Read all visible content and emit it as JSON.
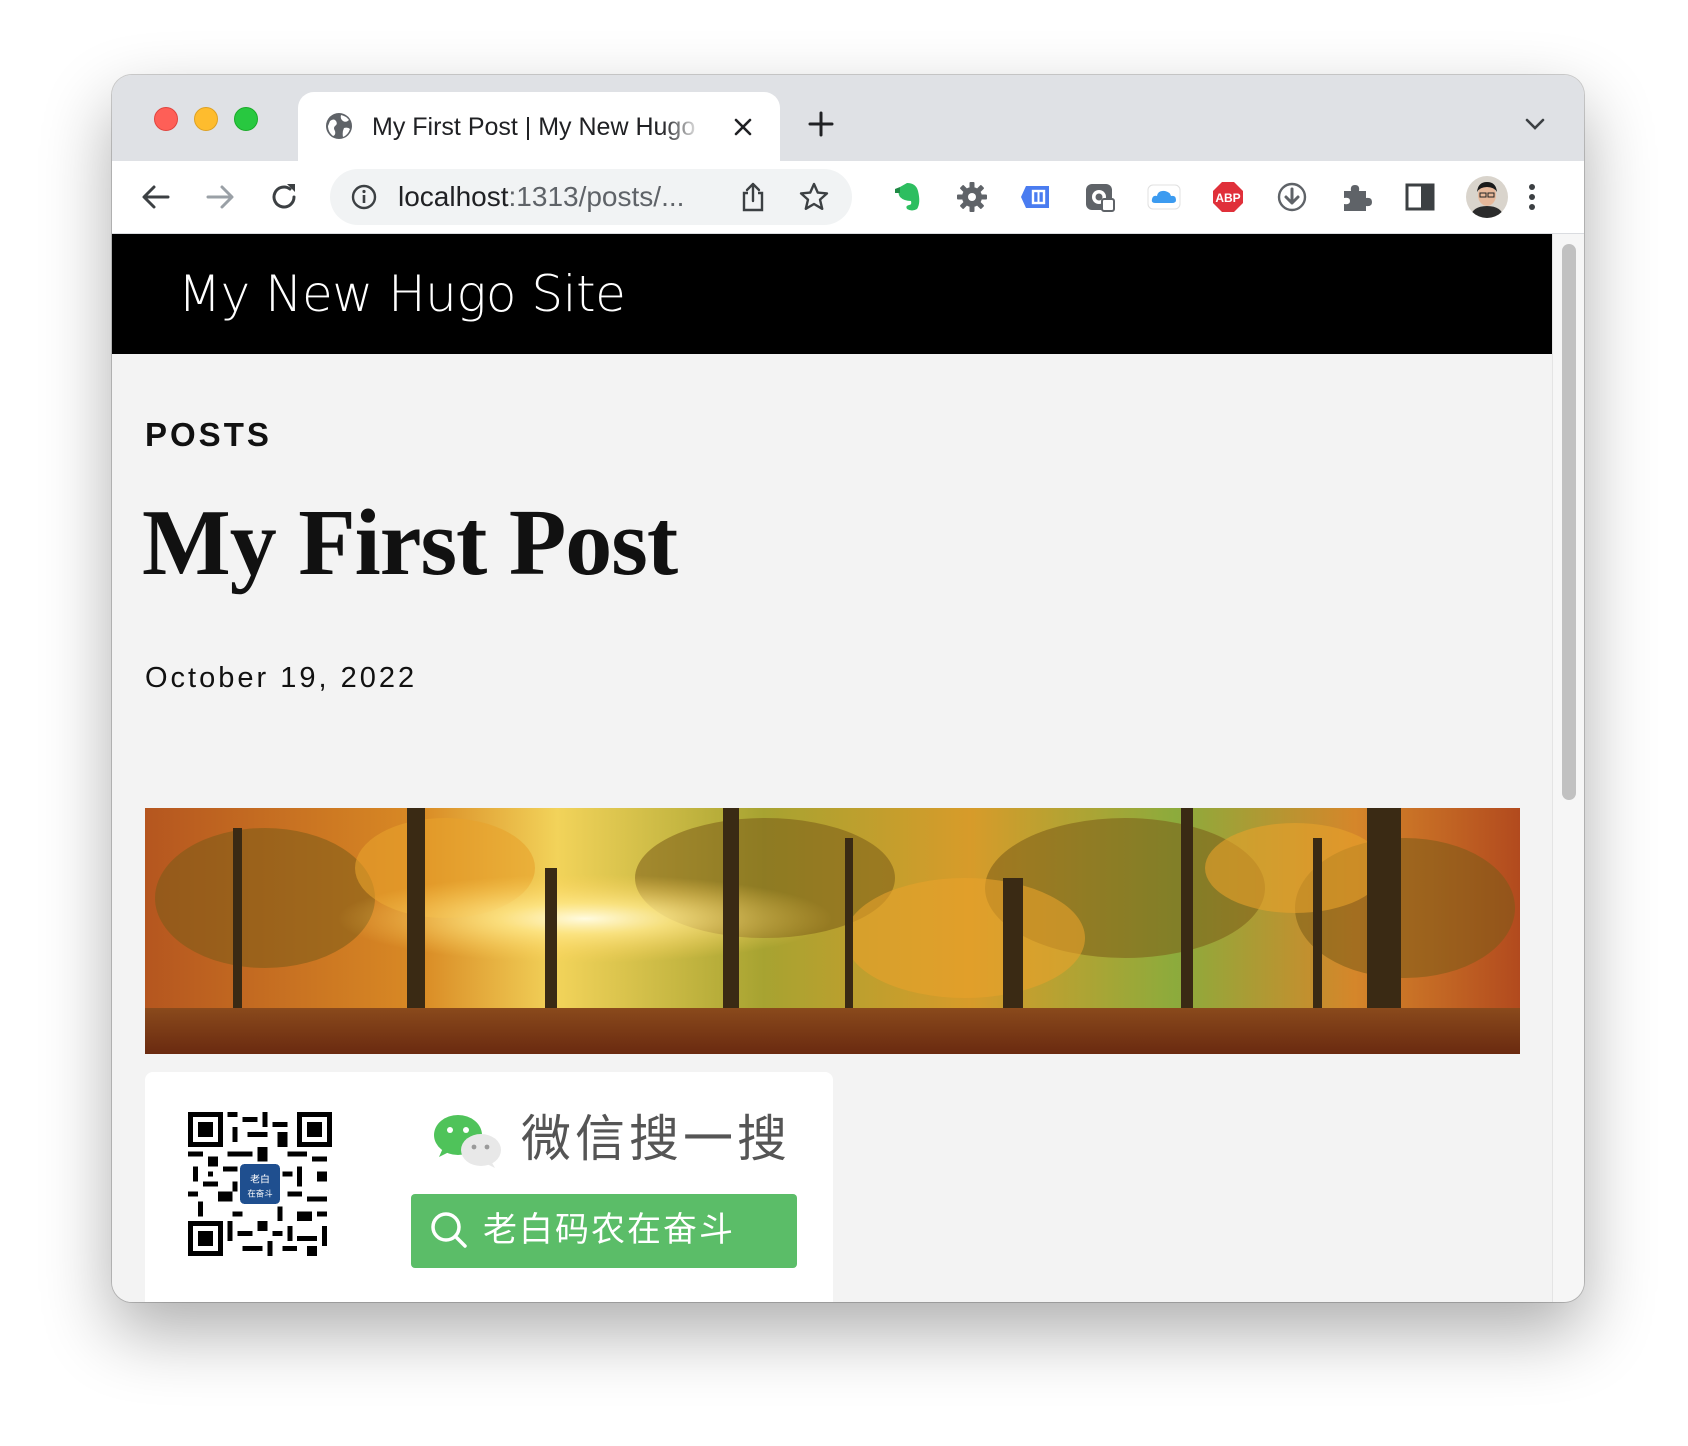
{
  "browser": {
    "tab": {
      "title": "My First Post | My New Hugo Site"
    },
    "address_bar": {
      "host": "localhost",
      "path": ":1313/posts/..."
    },
    "extensions": [
      "evernote-icon",
      "gear-extension-icon",
      "tag-extension-icon",
      "copy-extension-icon",
      "cloud-icon",
      "adblock-plus-icon",
      "download-icon",
      "puzzle-icon",
      "sidepanel-icon",
      "avatar"
    ],
    "adblock_label": "ABP"
  },
  "site": {
    "title": "My New Hugo Site"
  },
  "post": {
    "section": "POSTS",
    "title": "My First Post",
    "date": "October 19, 2022"
  },
  "promo": {
    "wechat_text": "微信搜一搜",
    "search_term": "老白码农在奋斗",
    "qr_label_top": "老白",
    "qr_label_bottom": "在奋斗"
  },
  "colors": {
    "header_bg": "#000000",
    "page_bg": "#f3f3f3",
    "wechat_green": "#5bbd68",
    "tab_strip": "#dfe1e5"
  }
}
